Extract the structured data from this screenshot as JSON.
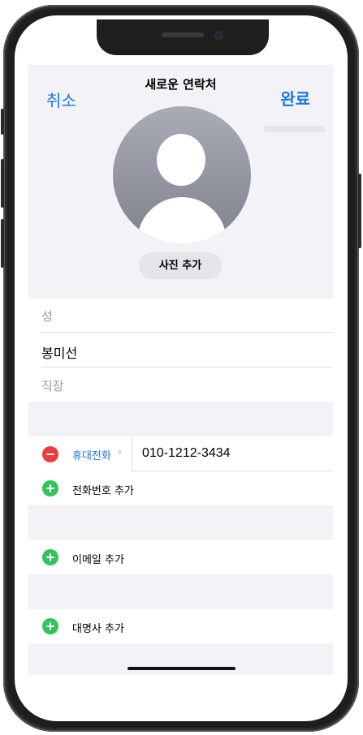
{
  "nav": {
    "title": "새로운 연락처",
    "cancel": "취소",
    "done": "완료"
  },
  "photo": {
    "add_label": "사진 추가"
  },
  "name_fields": {
    "last_name_placeholder": "성",
    "first_name_value": "봉미선",
    "company_placeholder": "직장"
  },
  "phone_section": {
    "type_label": "휴대전화",
    "number": "010-1212-3434",
    "add_label": "전화번호 추가"
  },
  "email_section": {
    "add_label": "이메일 추가"
  },
  "pronoun_section": {
    "add_label": "대명사 추가"
  },
  "colors": {
    "accent": "#1a78e0",
    "remove": "#ee3b3b",
    "add": "#32c35a"
  }
}
